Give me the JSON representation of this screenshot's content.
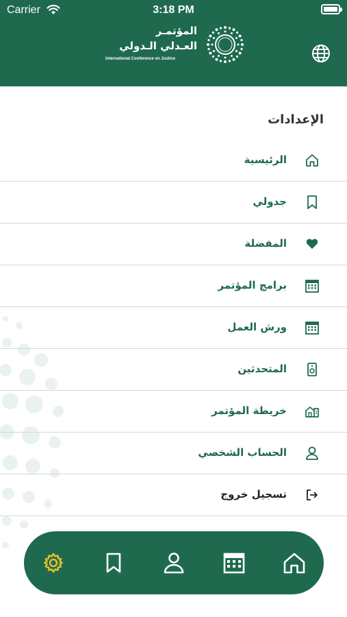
{
  "status_bar": {
    "carrier": "Carrier",
    "time": "3:18 PM"
  },
  "header": {
    "logo_line1": "المؤتمـر",
    "logo_line2": "العـدلي الـدولي",
    "logo_english": "International Conference on Justice",
    "language_icon": "globe-icon"
  },
  "settings": {
    "title": "الإعدادات",
    "items": [
      {
        "label": "الرئيسية",
        "icon": "home-icon"
      },
      {
        "label": "جدولي",
        "icon": "bookmark-icon"
      },
      {
        "label": "المفضلة",
        "icon": "heart-icon"
      },
      {
        "label": "برامج المؤتمر",
        "icon": "calendar-icon"
      },
      {
        "label": "ورش العمل",
        "icon": "calendar-icon"
      },
      {
        "label": "المتحدثين",
        "icon": "speaker-icon"
      },
      {
        "label": "خريطة المؤتمر",
        "icon": "map-building-icon"
      },
      {
        "label": "الحساب الشخصي",
        "icon": "person-icon"
      },
      {
        "label": "تسجيل خروج",
        "icon": "logout-icon"
      }
    ]
  },
  "tab_bar": {
    "tabs": [
      {
        "icon": "gear-icon",
        "active": true
      },
      {
        "icon": "bookmark-icon",
        "active": false
      },
      {
        "icon": "person-icon",
        "active": false
      },
      {
        "icon": "calendar-icon",
        "active": false
      },
      {
        "icon": "home-icon",
        "active": false
      }
    ]
  },
  "colors": {
    "brand_green": "#1f6a4e",
    "active_tab": "#e2c02a",
    "divider": "#d6d6d6"
  }
}
